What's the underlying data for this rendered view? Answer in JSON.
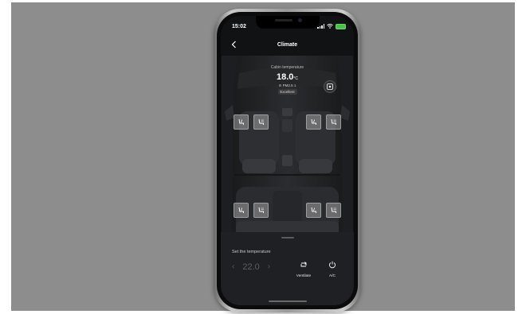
{
  "status_bar": {
    "time": "15:02"
  },
  "header": {
    "title": "Climate"
  },
  "cabin": {
    "label": "Cabin temperature",
    "temp_value": "18.0",
    "temp_unit": "°C",
    "pm_label": "PM2.5",
    "pm_value": "1",
    "air_quality": "Excellent"
  },
  "seat_buttons": [
    {
      "name": "front-left-seat-heat-button",
      "icon": "seat-heat-icon"
    },
    {
      "name": "front-left-seat-vent-button",
      "icon": "seat-vent-icon"
    },
    {
      "name": "front-right-seat-heat-button",
      "icon": "seat-heat-icon"
    },
    {
      "name": "front-right-seat-vent-button",
      "icon": "seat-vent-icon"
    },
    {
      "name": "rear-left-seat-heat-button",
      "icon": "seat-heat-icon"
    },
    {
      "name": "rear-left-seat-vent-button",
      "icon": "seat-vent-icon"
    },
    {
      "name": "rear-right-seat-heat-button",
      "icon": "seat-heat-icon"
    },
    {
      "name": "rear-right-seat-vent-button",
      "icon": "seat-vent-icon"
    }
  ],
  "panel": {
    "set_label": "Set the temperature",
    "temp_value": "22.0",
    "ventilate_label": "Ventilate",
    "ac_label": "A/C"
  },
  "colors": {
    "background": "#8d8d8d",
    "screen": "#111214",
    "battery": "#47c247",
    "panel": "#1f2023"
  }
}
